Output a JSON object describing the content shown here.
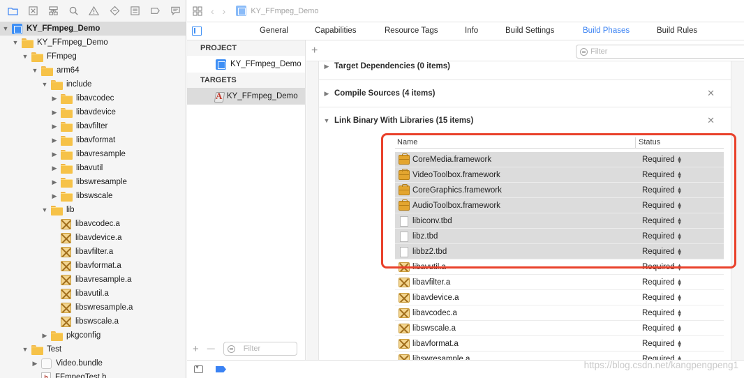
{
  "navigator": {
    "toolbar_icons": [
      "folder-icon",
      "source-control-icon",
      "symbol-icon",
      "find-icon",
      "issue-icon",
      "test-icon",
      "debug-icon",
      "breakpoint-icon",
      "report-icon"
    ],
    "tree": [
      {
        "label": "KY_FFmpeg_Demo",
        "icon": "project",
        "depth": 0,
        "expanded": true,
        "selected": true
      },
      {
        "label": "KY_FFmpeg_Demo",
        "icon": "folder",
        "depth": 1,
        "expanded": true
      },
      {
        "label": "FFmpeg",
        "icon": "folder",
        "depth": 2,
        "expanded": true
      },
      {
        "label": "arm64",
        "icon": "folder",
        "depth": 3,
        "expanded": true
      },
      {
        "label": "include",
        "icon": "folder",
        "depth": 4,
        "expanded": true
      },
      {
        "label": "libavcodec",
        "icon": "folder",
        "depth": 5,
        "expanded": false
      },
      {
        "label": "libavdevice",
        "icon": "folder",
        "depth": 5,
        "expanded": false
      },
      {
        "label": "libavfilter",
        "icon": "folder",
        "depth": 5,
        "expanded": false
      },
      {
        "label": "libavformat",
        "icon": "folder",
        "depth": 5,
        "expanded": false
      },
      {
        "label": "libavresample",
        "icon": "folder",
        "depth": 5,
        "expanded": false
      },
      {
        "label": "libavutil",
        "icon": "folder",
        "depth": 5,
        "expanded": false
      },
      {
        "label": "libswresample",
        "icon": "folder",
        "depth": 5,
        "expanded": false
      },
      {
        "label": "libswscale",
        "icon": "folder",
        "depth": 5,
        "expanded": false
      },
      {
        "label": "lib",
        "icon": "folder",
        "depth": 4,
        "expanded": true
      },
      {
        "label": "libavcodec.a",
        "icon": "lib",
        "depth": 5
      },
      {
        "label": "libavdevice.a",
        "icon": "lib",
        "depth": 5
      },
      {
        "label": "libavfilter.a",
        "icon": "lib",
        "depth": 5
      },
      {
        "label": "libavformat.a",
        "icon": "lib",
        "depth": 5
      },
      {
        "label": "libavresample.a",
        "icon": "lib",
        "depth": 5
      },
      {
        "label": "libavutil.a",
        "icon": "lib",
        "depth": 5
      },
      {
        "label": "libswresample.a",
        "icon": "lib",
        "depth": 5
      },
      {
        "label": "libswscale.a",
        "icon": "lib",
        "depth": 5
      },
      {
        "label": "pkgconfig",
        "icon": "folder",
        "depth": 4,
        "expanded": false
      },
      {
        "label": "Test",
        "icon": "folder",
        "depth": 2,
        "expanded": true
      },
      {
        "label": "Video.bundle",
        "icon": "bundle",
        "depth": 3,
        "expanded": false
      },
      {
        "label": "FFmpegTest.h",
        "icon": "header",
        "depth": 3
      }
    ]
  },
  "jump_bar": {
    "crumb": "KY_FFmpeg_Demo"
  },
  "tabs": [
    {
      "label": "General",
      "active": false
    },
    {
      "label": "Capabilities",
      "active": false
    },
    {
      "label": "Resource Tags",
      "active": false
    },
    {
      "label": "Info",
      "active": false
    },
    {
      "label": "Build Settings",
      "active": false
    },
    {
      "label": "Build Phases",
      "active": true
    },
    {
      "label": "Build Rules",
      "active": false
    }
  ],
  "targets_list": {
    "project_header": "PROJECT",
    "project_item": "KY_FFmpeg_Demo",
    "targets_header": "TARGETS",
    "target_item": "KY_FFmpeg_Demo",
    "add_symbol": "+",
    "remove_symbol": "—",
    "filter_placeholder": "Filter"
  },
  "phases": {
    "add_symbol": "+",
    "filter_placeholder": "Filter",
    "items": [
      {
        "label": "Target Dependencies (0 items)",
        "expanded": false,
        "closable": false
      },
      {
        "label": "Compile Sources (4 items)",
        "expanded": false,
        "closable": true
      },
      {
        "label": "Link Binary With Libraries (15 items)",
        "expanded": true,
        "closable": true
      }
    ],
    "table": {
      "col_name": "Name",
      "col_status": "Status",
      "rows": [
        {
          "name": "CoreMedia.framework",
          "status": "Required",
          "icon": "framework",
          "selected": true
        },
        {
          "name": "VideoToolbox.framework",
          "status": "Required",
          "icon": "framework",
          "selected": true
        },
        {
          "name": "CoreGraphics.framework",
          "status": "Required",
          "icon": "framework",
          "selected": true
        },
        {
          "name": "AudioToolbox.framework",
          "status": "Required",
          "icon": "framework",
          "selected": true
        },
        {
          "name": "libiconv.tbd",
          "status": "Required",
          "icon": "tbd",
          "selected": true
        },
        {
          "name": "libz.tbd",
          "status": "Required",
          "icon": "tbd",
          "selected": true
        },
        {
          "name": "libbz2.tbd",
          "status": "Required",
          "icon": "tbd",
          "selected": true
        },
        {
          "name": "libavutil.a",
          "status": "Required",
          "icon": "archive",
          "selected": false
        },
        {
          "name": "libavfilter.a",
          "status": "Required",
          "icon": "archive",
          "selected": false
        },
        {
          "name": "libavdevice.a",
          "status": "Required",
          "icon": "archive",
          "selected": false
        },
        {
          "name": "libavcodec.a",
          "status": "Required",
          "icon": "archive",
          "selected": false
        },
        {
          "name": "libswscale.a",
          "status": "Required",
          "icon": "archive",
          "selected": false
        },
        {
          "name": "libavformat.a",
          "status": "Required",
          "icon": "archive",
          "selected": false
        },
        {
          "name": "libswresample.a",
          "status": "Required",
          "icon": "archive",
          "selected": false
        }
      ]
    }
  },
  "watermark": "https://blog.csdn.net/kangpengpeng1",
  "colors": {
    "accent": "#3a82f3",
    "highlight": "#e9412b",
    "selection": "#dcdcdc"
  }
}
